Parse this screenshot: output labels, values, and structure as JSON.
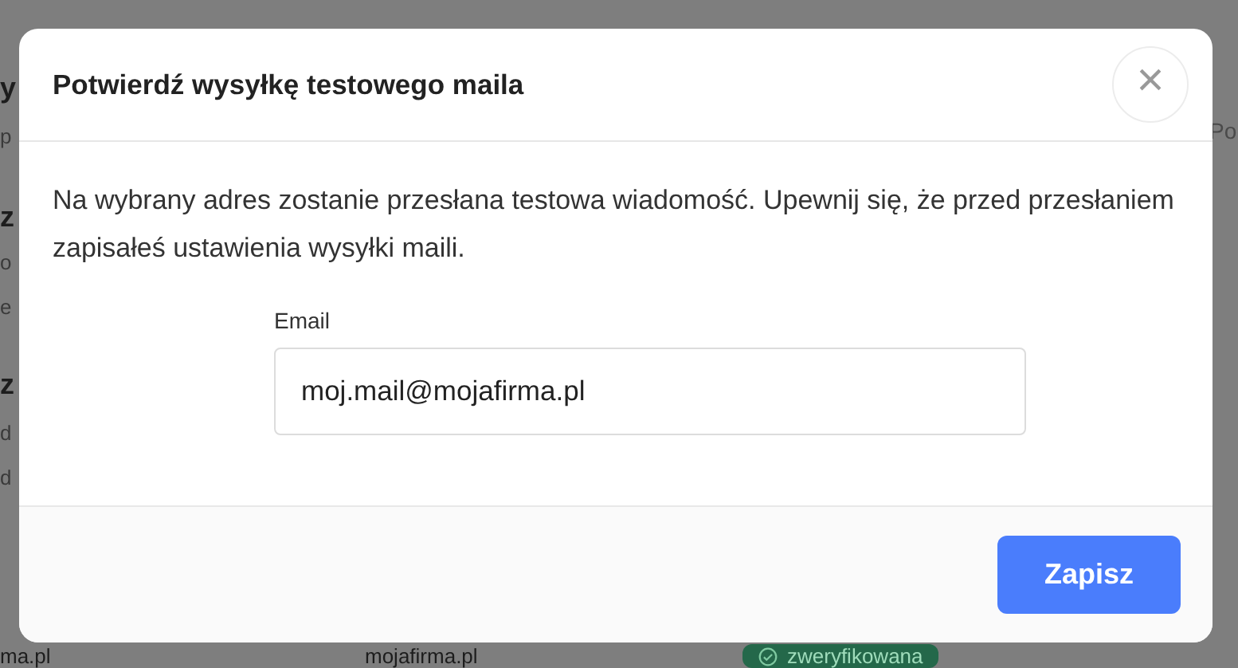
{
  "background": {
    "left_fragments": [
      {
        "kind": "heading",
        "text": "y"
      },
      {
        "kind": "small",
        "text": "p"
      },
      {
        "kind": "heading",
        "text": "z"
      },
      {
        "kind": "small",
        "text": "o"
      },
      {
        "kind": "small",
        "text": "e"
      },
      {
        "kind": "heading",
        "text": "z"
      },
      {
        "kind": "small",
        "text": "d"
      },
      {
        "kind": "small",
        "text": "d"
      }
    ],
    "right_fragment": "Po",
    "bottom_row": {
      "column_1": "ma.pl",
      "column_2": "mojafirma.pl",
      "status": "zweryfikowana"
    }
  },
  "modal": {
    "title": "Potwierdź wysyłkę testowego maila",
    "close": "×",
    "message": "Na wybrany adres zostanie przesłana testowa wiadomość. Upewnij się, że przed przesłaniem zapisałeś ustawienia wysyłki maili.",
    "email": {
      "label": "Email",
      "value": "moj.mail@mojafirma.pl"
    },
    "buttons": [
      "Zapisz"
    ]
  }
}
